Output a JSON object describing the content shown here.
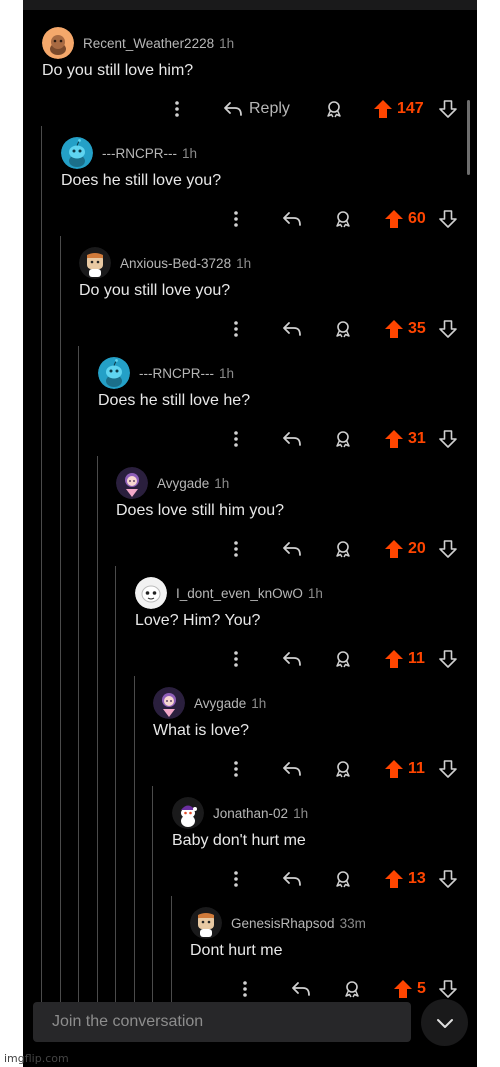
{
  "comments": [
    {
      "username": "Recent_Weather2228",
      "time": "1h",
      "text": "Do you still love him?",
      "score": "147",
      "reply_label": "Reply",
      "avatar": "orange-snoo-avatar",
      "avatar_color": "#f5a86b"
    },
    {
      "username": "---RNCPR---",
      "time": "1h",
      "text": "Does he still love you?",
      "score": "60",
      "avatar": "cyan-snoo-avatar",
      "avatar_color": "#24a0c7"
    },
    {
      "username": "Anxious-Bed-3728",
      "time": "1h",
      "text": "Do you still love you?",
      "score": "35",
      "avatar": "custom-snoo-avatar",
      "avatar_color": "#e8c9a3"
    },
    {
      "username": "---RNCPR---",
      "time": "1h",
      "text": "Does he still love he?",
      "score": "31",
      "avatar": "cyan-snoo-avatar",
      "avatar_color": "#24a0c7"
    },
    {
      "username": "Avygade",
      "time": "1h",
      "text": "Does love still him you?",
      "score": "20",
      "avatar": "anime-girl-avatar",
      "avatar_color": "#8e5fb8"
    },
    {
      "username": "I_dont_even_knOwO",
      "time": "1h",
      "text": "Love? Him? You?",
      "score": "11",
      "avatar": "white-blob-avatar",
      "avatar_color": "#f2f2f2"
    },
    {
      "username": "Avygade",
      "time": "1h",
      "text": "What is love?",
      "score": "11",
      "avatar": "anime-girl-avatar",
      "avatar_color": "#8e5fb8"
    },
    {
      "username": "Jonathan-02",
      "time": "1h",
      "text": "Baby don't hurt me",
      "score": "13",
      "avatar": "santa-snoo-avatar",
      "avatar_color": "#ffffff"
    },
    {
      "username": "GenesisRhapsod",
      "time": "33m",
      "text": "Dont hurt me",
      "score": "5",
      "avatar": "custom-snoo-avatar",
      "avatar_color": "#e8c9a3"
    }
  ],
  "composer": {
    "placeholder": "Join the conversation"
  },
  "watermark": "imgflip.com",
  "colors": {
    "background": "#000000",
    "upvoted": "#ff4500",
    "text": "#e8e8e8",
    "meta": "#b7b7b7",
    "thread_line": "#4b4b4b"
  }
}
